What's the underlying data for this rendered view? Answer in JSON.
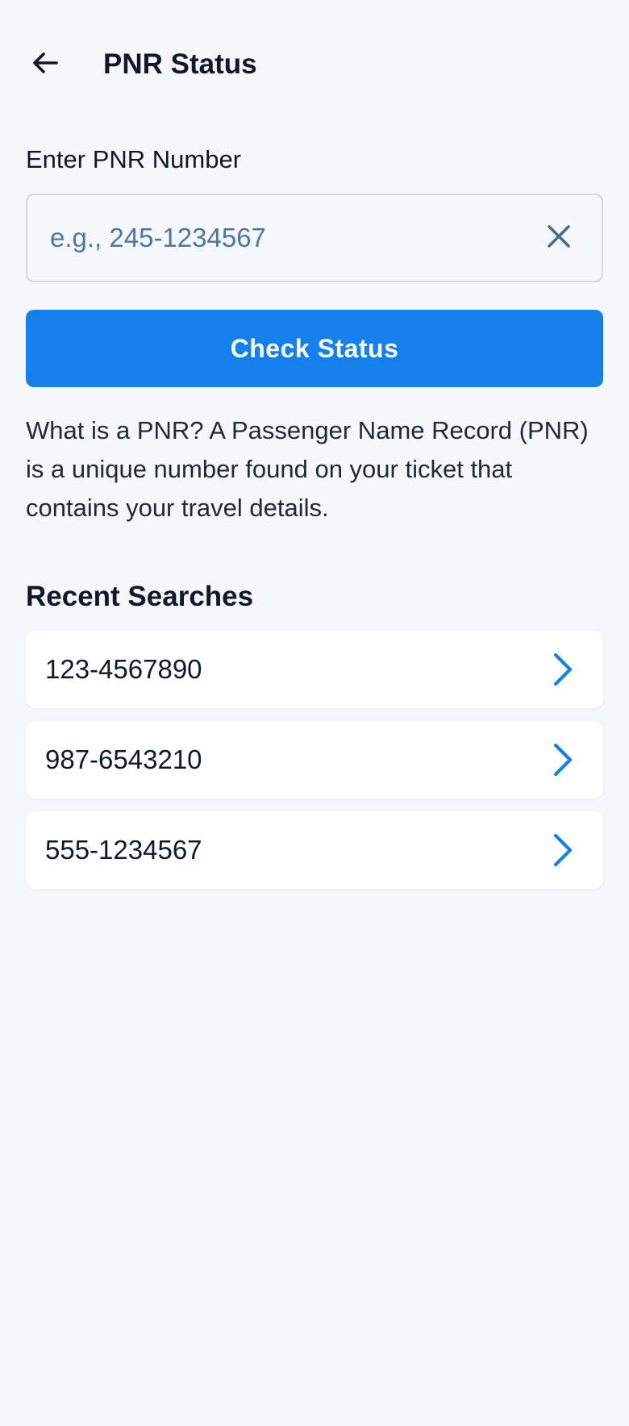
{
  "header": {
    "title": "PNR Status",
    "back_icon": "arrow-left-icon"
  },
  "form": {
    "label": "Enter PNR Number",
    "input_value": "",
    "input_placeholder": "e.g., 245-1234567",
    "clear_icon": "close-icon",
    "submit_label": "Check Status"
  },
  "info": {
    "text": "What is a PNR? A Passenger Name Record (PNR) is a unique number found on your ticket that contains your travel details."
  },
  "recent": {
    "title": "Recent Searches",
    "items": [
      {
        "number": "123-4567890",
        "icon": "chevron-right-icon"
      },
      {
        "number": "987-6543210",
        "icon": "chevron-right-icon"
      },
      {
        "number": "555-1234567",
        "icon": "chevron-right-icon"
      }
    ]
  },
  "colors": {
    "background": "#f5f7fa",
    "accent": "#1580ea",
    "placeholder": "#4f76a3",
    "card": "#ffffff"
  }
}
